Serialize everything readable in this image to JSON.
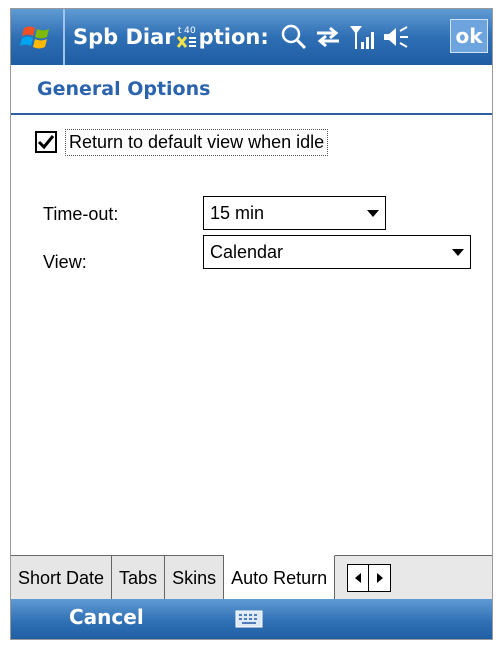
{
  "titlebar": {
    "app_title": "Spb Diar",
    "title_suffix": "ption:",
    "ok_label": "ok"
  },
  "header": {
    "title": "General Options"
  },
  "options": {
    "return_checkbox_label": "Return to default view when idle",
    "return_checked": true,
    "timeout_label": "Time-out:",
    "timeout_value": "15 min",
    "view_label": "View:",
    "view_value": "Calendar"
  },
  "tabs": [
    {
      "label": "Short Date",
      "active": false
    },
    {
      "label": "Tabs",
      "active": false
    },
    {
      "label": "Skins",
      "active": false
    },
    {
      "label": "Auto Return",
      "active": true
    }
  ],
  "bottombar": {
    "cancel_label": "Cancel"
  },
  "icons": {
    "start": "windows-flag-icon",
    "search": "search-icon",
    "connectivity": "sync-arrows-icon",
    "signal": "signal-strength-icon",
    "volume": "speaker-icon",
    "keyboard": "keyboard-icon"
  },
  "colors": {
    "titlebar": "#2f6fb4",
    "header_text": "#2b64ad"
  }
}
